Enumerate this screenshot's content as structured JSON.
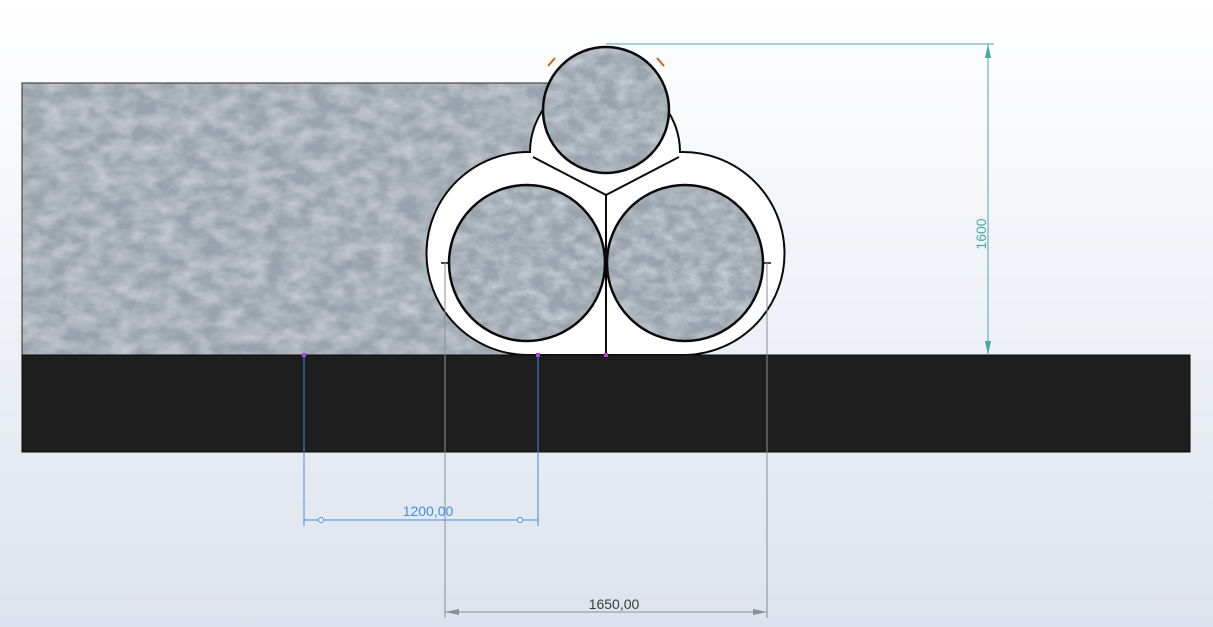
{
  "dimensions": {
    "height": "1600",
    "spacing": "1200,00",
    "width": "1650,00"
  },
  "colors": {
    "background_light": "#ffffff",
    "background_shade": "#dde3ee",
    "ground_fill": "#1e1e1e",
    "texture_base": "#9aa3ad",
    "outline": "#0a0a0a",
    "dim_teal": "#45a8a4",
    "dim_blue": "#3d8fe0",
    "dim_gray": "#8a8f96",
    "point_magenta": "#c03ad6",
    "arrow_orange": "#c8641e"
  }
}
